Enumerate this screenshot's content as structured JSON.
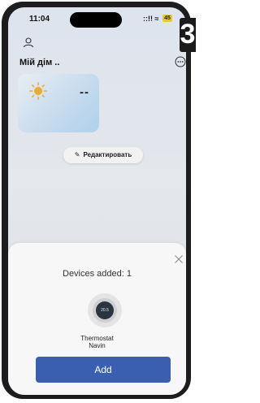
{
  "status_bar": {
    "time": "11:04",
    "signal": "::!! ≈",
    "battery": "45"
  },
  "badge": "3",
  "header": {
    "title": "Мій дім .."
  },
  "weather": {
    "temperature": "--"
  },
  "edit_button": {
    "label": "Редактировать"
  },
  "sheet": {
    "devices_added": "Devices added: 1",
    "thermostat_display": "20.5",
    "device_name_line1": "Thermostat",
    "device_name_line2": "Navin",
    "add_label": "Add"
  },
  "colors": {
    "accent": "#3a5fb0",
    "sun": "#f5b731"
  }
}
